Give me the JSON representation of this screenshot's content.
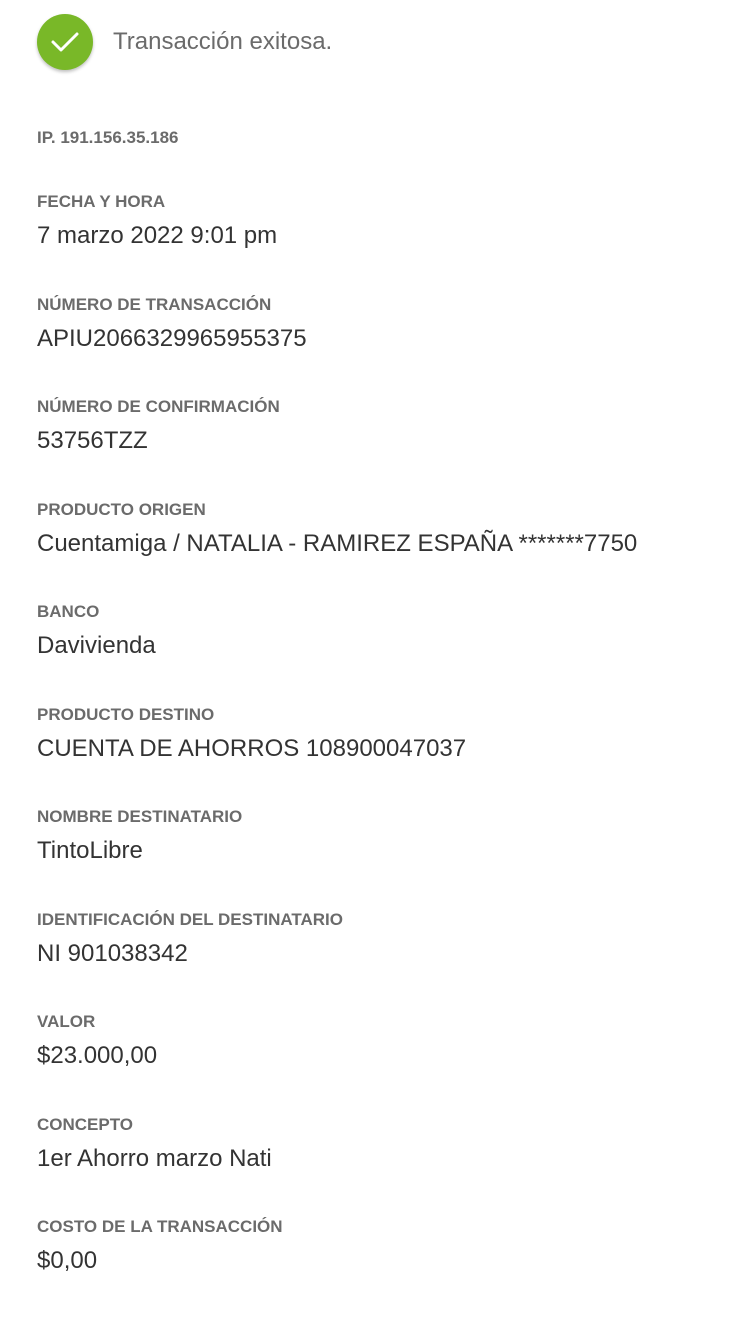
{
  "status": {
    "icon": "check-icon",
    "color": "#79b828",
    "text": "Transacción exitosa."
  },
  "ip": "IP. 191.156.35.186",
  "fields": [
    {
      "label": "FECHA Y HORA",
      "value": "7 marzo 2022 9:01 pm"
    },
    {
      "label": "NÚMERO DE TRANSACCIÓN",
      "value": "APIU2066329965955375"
    },
    {
      "label": "NÚMERO DE CONFIRMACIÓN",
      "value": "53756TZZ"
    },
    {
      "label": "PRODUCTO ORIGEN",
      "value": "Cuentamiga / NATALIA - RAMIREZ ESPAÑA *******7750"
    },
    {
      "label": "BANCO",
      "value": "Davivienda"
    },
    {
      "label": "PRODUCTO DESTINO",
      "value": "CUENTA DE AHORROS 108900047037"
    },
    {
      "label": "NOMBRE DESTINATARIO",
      "value": "TintoLibre"
    },
    {
      "label": "IDENTIFICACIÓN DEL DESTINATARIO",
      "value": "NI 901038342"
    },
    {
      "label": "VALOR",
      "value": "$23.000,00"
    },
    {
      "label": "CONCEPTO",
      "value": "1er Ahorro marzo Nati"
    },
    {
      "label": "COSTO DE LA TRANSACCIÓN",
      "value": "$0,00"
    }
  ]
}
